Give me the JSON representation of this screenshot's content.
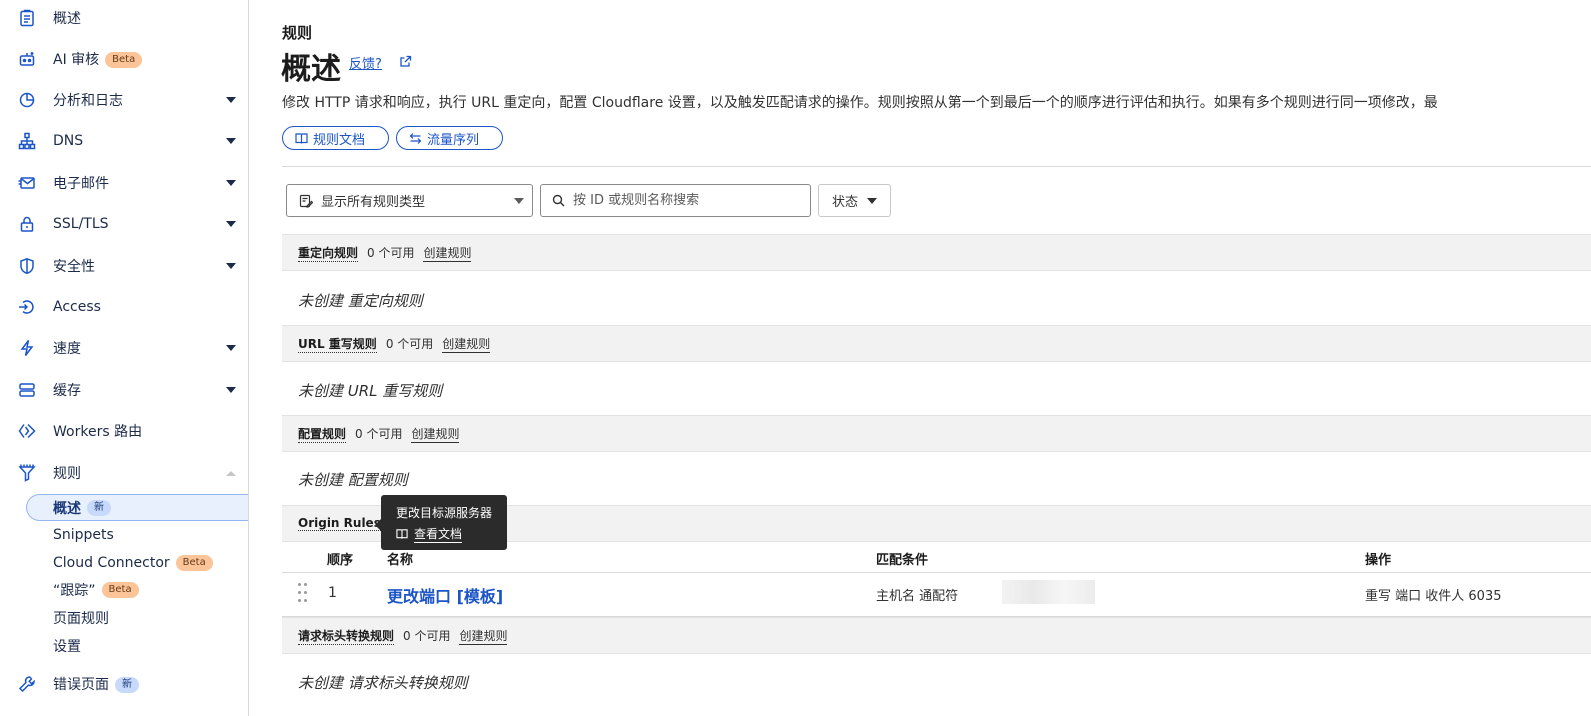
{
  "sidebar": {
    "items": [
      {
        "label": "概述",
        "icon": "clipboard-icon"
      },
      {
        "label": "AI 审核",
        "icon": "robot-icon",
        "badge": "Beta"
      },
      {
        "label": "分析和日志",
        "icon": "pie-chart-icon"
      },
      {
        "label": "DNS",
        "icon": "network-icon"
      },
      {
        "label": "电子邮件",
        "icon": "email-icon"
      },
      {
        "label": "SSL/TLS",
        "icon": "lock-icon"
      },
      {
        "label": "安全性",
        "icon": "shield-icon"
      },
      {
        "label": "Access",
        "icon": "access-icon"
      },
      {
        "label": "速度",
        "icon": "lightning-icon"
      },
      {
        "label": "缓存",
        "icon": "database-icon"
      },
      {
        "label": "Workers 路由",
        "icon": "workers-icon"
      },
      {
        "label": "规则",
        "icon": "rules-funnel-icon"
      }
    ],
    "sub_items": [
      {
        "label": "概述",
        "badge": "新"
      },
      {
        "label": "Snippets"
      },
      {
        "label": "Cloud Connector",
        "badge": "Beta"
      },
      {
        "label": "“跟踪”",
        "badge": "Beta"
      },
      {
        "label": "页面规则"
      },
      {
        "label": "设置"
      }
    ],
    "bottom_item": {
      "label": "错误页面",
      "icon": "wrench-icon",
      "badge": "新"
    }
  },
  "header": {
    "breadcrumb": "规则",
    "title": "概述",
    "feedback": "反馈?",
    "description": "修改 HTTP 请求和响应，执行 URL 重定向，配置 Cloudflare 设置，以及触发匹配请求的操作。规则按照从第一个到最后一个的顺序进行评估和执行。如果有多个规则进行同一项修改，最",
    "docs_button": "规则文档",
    "sequence_button": "流量序列"
  },
  "filters": {
    "type_select": "显示所有规则类型",
    "search_placeholder": "按 ID 或规则名称搜索",
    "status": "状态"
  },
  "sections": [
    {
      "name": "重定向规则",
      "count": "0 个可用",
      "create": "创建规则",
      "empty": "未创建 重定向规则"
    },
    {
      "name": "URL 重写规则",
      "count": "0 个可用",
      "create": "创建规则",
      "empty": "未创建 URL 重写规则"
    },
    {
      "name": "配置规则",
      "count": "0 个可用",
      "create": "创建规则",
      "empty": "未创建 配置规则"
    },
    {
      "name": "Origin Rules"
    },
    {
      "name": "请求标头转换规则",
      "count": "0 个可用",
      "create": "创建规则",
      "empty": "未创建 请求标头转换规则"
    }
  ],
  "origin_table": {
    "columns": [
      "顺序",
      "名称",
      "匹配条件",
      "操作"
    ],
    "rows": [
      {
        "order": "1",
        "name": "更改端口 [模板]",
        "match": "主机名 通配符",
        "action": "重写 端口 收件人 6035"
      }
    ]
  },
  "tooltip": {
    "title": "更改目标源服务器",
    "link": "查看文档"
  },
  "colors": {
    "accent": "#1b55c8",
    "beta_badge": "#fbc599",
    "new_badge": "#c7dafc"
  }
}
